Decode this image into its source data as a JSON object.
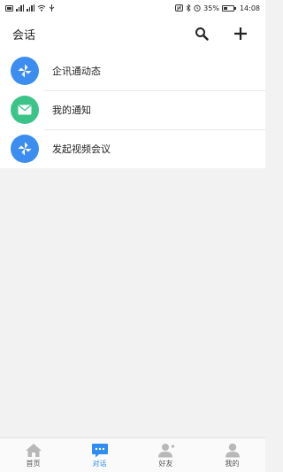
{
  "status_bar": {
    "battery": "35%",
    "time": "14:08"
  },
  "header": {
    "title": "会话"
  },
  "list": [
    {
      "label": "企讯通动态",
      "icon": "pinwheel-icon",
      "color": "#3b8df0"
    },
    {
      "label": "我的通知",
      "icon": "mail-icon",
      "color": "#3cc488"
    },
    {
      "label": "发起视频会议",
      "icon": "pinwheel-icon",
      "color": "#3b8df0"
    }
  ],
  "tabbar": [
    {
      "label": "首页",
      "icon": "home-icon"
    },
    {
      "label": "对话",
      "icon": "chat-icon",
      "active": true
    },
    {
      "label": "好友",
      "icon": "friends-icon"
    },
    {
      "label": "我的",
      "icon": "profile-icon"
    }
  ],
  "colors": {
    "accent": "#2f8cf0",
    "green": "#3cc488",
    "inactive_icon": "#b8b8b8"
  }
}
